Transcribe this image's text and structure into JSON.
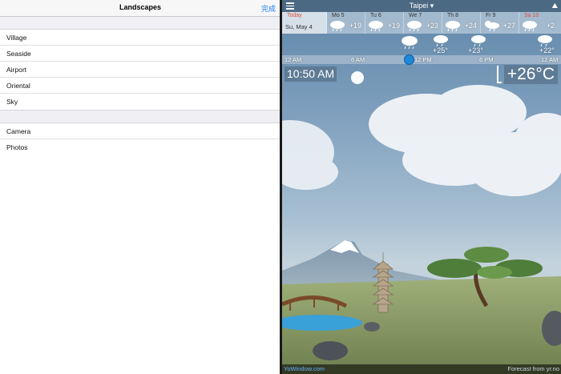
{
  "settings": {
    "title": "Landscapes",
    "done_label": "完成",
    "landscapes": [
      {
        "label": "Village"
      },
      {
        "label": "Seaside"
      },
      {
        "label": "Airport"
      },
      {
        "label": "Oriental"
      },
      {
        "label": "Sky"
      }
    ],
    "sources": [
      {
        "label": "Camera"
      },
      {
        "label": "Photos"
      }
    ]
  },
  "weather": {
    "city": "Taipei",
    "city_dropdown_glyph": "▾",
    "forecast": [
      {
        "name": "Today",
        "date": "Su, May 4",
        "icon": "none",
        "temp": "",
        "name_color": "red"
      },
      {
        "name": "Mo 5",
        "icon": "rain-cloud-icon",
        "temp": "+19"
      },
      {
        "name": "Tu 6",
        "icon": "rain-cloud-icon",
        "temp": "+19"
      },
      {
        "name": "We 7",
        "icon": "rain-cloud-icon",
        "temp": "+23"
      },
      {
        "name": "Th 8",
        "icon": "rain-cloud-icon",
        "temp": "+24"
      },
      {
        "name": "Fr 9",
        "icon": "sun-cloud-rain-icon",
        "temp": "+27"
      },
      {
        "name": "Sa 10",
        "icon": "rain-cloud-icon",
        "temp": "+2",
        "name_color": "red"
      }
    ],
    "hourly": [
      {
        "icon": "rain-cloud-icon",
        "temp": "+25°"
      },
      {
        "icon": "rain-cloud-icon",
        "temp": "+23°"
      },
      {
        "icon": "rain-cloud-icon",
        "temp": "+22°"
      }
    ],
    "timeline": [
      "12 AM",
      "6 AM",
      "12 PM",
      "6 PM",
      "12 AM"
    ],
    "current_time": "10:50 AM",
    "current_temp": "+26°C",
    "footer_left": "YoWindow.com",
    "footer_right": "Forecast from yr.no"
  },
  "colors": {
    "accent": "#1a7cf5",
    "red_day": "#e04a3a",
    "timeline_knob": "#1e88d8"
  }
}
